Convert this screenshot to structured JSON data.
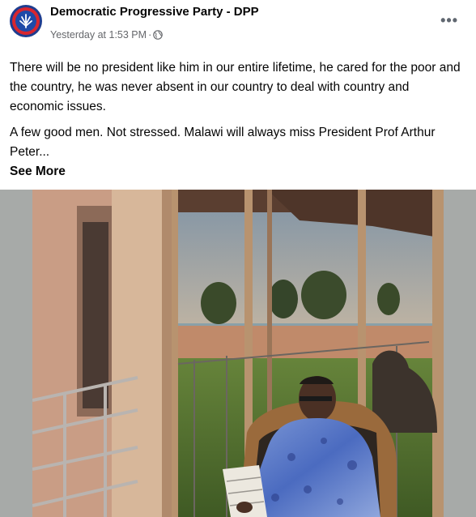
{
  "header": {
    "page_name": "Democratic Progressive Party - DPP",
    "timestamp": "Yesterday at 1:53 PM",
    "separator": "·",
    "more_label": "•••",
    "avatar_icon": "dpp-logo",
    "privacy_icon": "globe-icon"
  },
  "post": {
    "paragraph1": "There will be no president like him in our entire lifetime, he cared for the poor and the country, he was never absent in our country to deal with country and economic issues.",
    "paragraph2": "A few good men. Not stressed. Malawi will always miss President Prof Arthur Peter...",
    "see_more": "See More"
  },
  "photo": {
    "subject": "man in blue patterned shirt reading in a wooden chair on a balcony"
  },
  "colors": {
    "text": "#050505",
    "meta": "#65676b",
    "logo_blue": "#1f3d8f",
    "logo_red": "#d8262f"
  }
}
